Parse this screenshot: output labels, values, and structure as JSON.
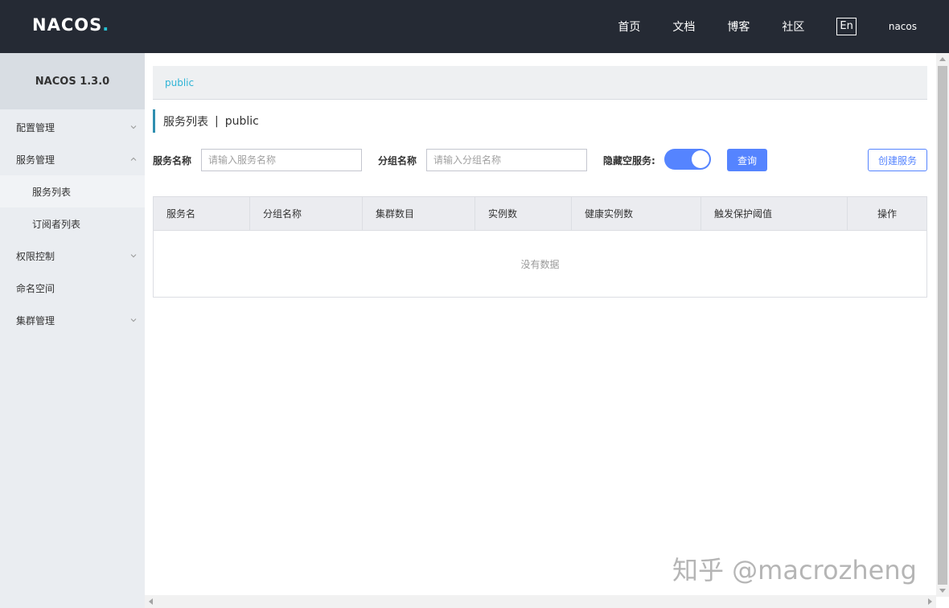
{
  "header": {
    "logo_text": "NACOS",
    "logo_dot": ".",
    "nav": [
      {
        "label": "首页"
      },
      {
        "label": "文档"
      },
      {
        "label": "博客"
      },
      {
        "label": "社区"
      }
    ],
    "language_button": "En",
    "username": "nacos"
  },
  "sidebar": {
    "version": "NACOS 1.3.0",
    "items": [
      {
        "label": "配置管理",
        "chevron": "chevron-down-icon"
      },
      {
        "label": "服务管理",
        "chevron": "chevron-up-icon"
      },
      {
        "label": "服务列表"
      },
      {
        "label": "订阅者列表"
      },
      {
        "label": "权限控制",
        "chevron": "chevron-down-icon"
      },
      {
        "label": "命名空间"
      },
      {
        "label": "集群管理",
        "chevron": "chevron-down-icon"
      }
    ]
  },
  "namespace_bar": {
    "current": "public"
  },
  "page_title": {
    "title": "服务列表",
    "separator": "|",
    "namespace": "public"
  },
  "filters": {
    "service_name_label": "服务名称",
    "service_name_placeholder": "请输入服务名称",
    "group_name_label": "分组名称",
    "group_name_placeholder": "请输入分组名称",
    "hide_empty_label": "隐藏空服务:",
    "hide_empty_on": true,
    "query_button": "查询",
    "create_button": "创建服务"
  },
  "table": {
    "columns": [
      "服务名",
      "分组名称",
      "集群数目",
      "实例数",
      "健康实例数",
      "触发保护阈值",
      "操作"
    ],
    "empty_text": "没有数据"
  },
  "watermark": "知乎 @macrozheng",
  "colors": {
    "header_bg": "#252a34",
    "sidebar_bg": "#eaedf1",
    "primary": "#5584ff",
    "namespace_link": "#2eb4d6",
    "title_accent": "#2f8fb0"
  }
}
